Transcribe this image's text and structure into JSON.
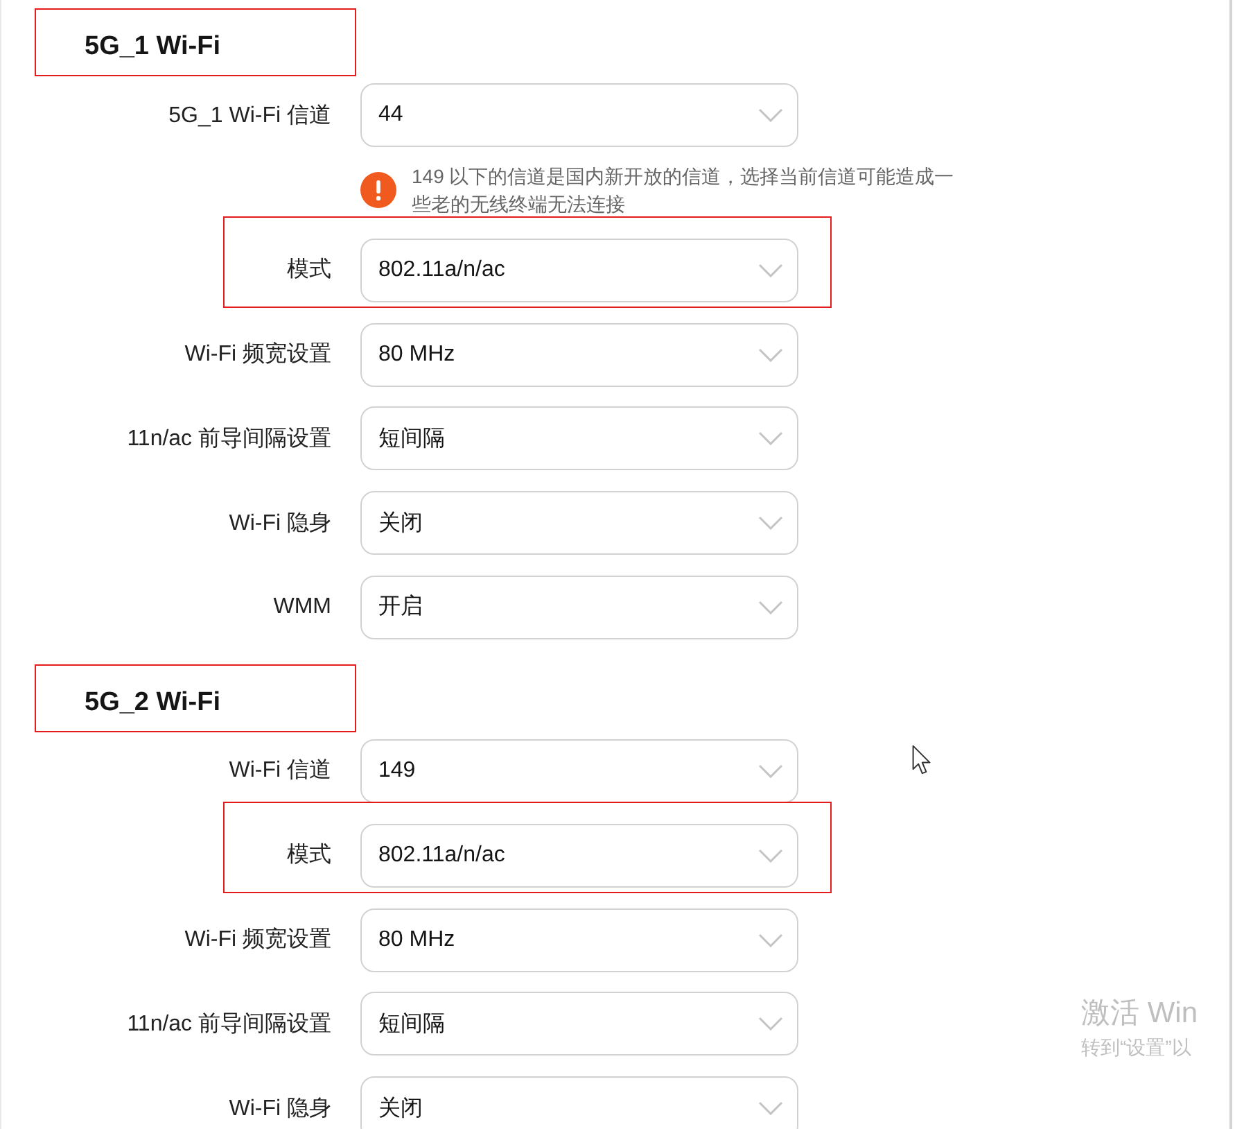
{
  "sections": [
    {
      "title": "5G_1 Wi-Fi",
      "highlighted": true,
      "fields": [
        {
          "label": "5G_1 Wi-Fi 信道",
          "value": "44",
          "highlighted": false,
          "hint": "149 以下的信道是国内新开放的信道，选择当前信道可能造成一些老的无线终端无法连接"
        },
        {
          "label": "模式",
          "value": "802.11a/n/ac",
          "highlighted": true
        },
        {
          "label": "Wi-Fi 频宽设置",
          "value": "80 MHz",
          "highlighted": false
        },
        {
          "label": "11n/ac 前导间隔设置",
          "value": "短间隔",
          "highlighted": false
        },
        {
          "label": "Wi-Fi 隐身",
          "value": "关闭",
          "highlighted": false
        },
        {
          "label": "WMM",
          "value": "开启",
          "highlighted": false
        }
      ]
    },
    {
      "title": "5G_2 Wi-Fi",
      "highlighted": true,
      "fields": [
        {
          "label": "Wi-Fi 信道",
          "value": "149",
          "highlighted": false
        },
        {
          "label": "模式",
          "value": "802.11a/n/ac",
          "highlighted": true
        },
        {
          "label": "Wi-Fi 频宽设置",
          "value": "80 MHz",
          "highlighted": false
        },
        {
          "label": "11n/ac 前导间隔设置",
          "value": "短间隔",
          "highlighted": false
        },
        {
          "label": "Wi-Fi 隐身",
          "value": "关闭",
          "highlighted": false
        }
      ]
    }
  ],
  "activation_notice": {
    "title": "激活 Win",
    "subtitle": "转到“设置”以"
  }
}
